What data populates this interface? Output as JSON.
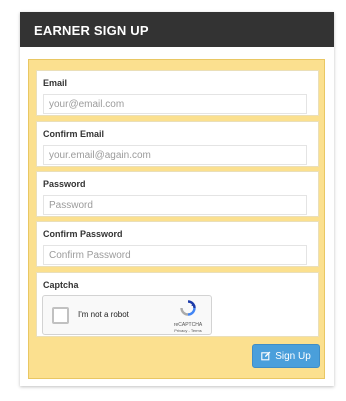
{
  "header": {
    "title": "EARNER SIGN UP"
  },
  "form": {
    "email": {
      "label": "Email",
      "placeholder": "your@email.com"
    },
    "confirm_email": {
      "label": "Confirm Email",
      "placeholder": "your.email@again.com"
    },
    "password": {
      "label": "Password",
      "placeholder": "Password"
    },
    "confirm_password": {
      "label": "Confirm Password",
      "placeholder": "Confirm Password"
    },
    "captcha": {
      "label": "Captcha",
      "checkbox_text": "I'm not a robot",
      "brand": "reCAPTCHA",
      "links": "Privacy - Terms"
    },
    "submit_label": "Sign Up"
  },
  "colors": {
    "header_bg": "#333333",
    "panel_bg": "#fbe08f",
    "button_bg": "#4a9fdb"
  },
  "icons": {
    "submit": "edit-icon",
    "captcha_logo": "recaptcha-icon"
  }
}
